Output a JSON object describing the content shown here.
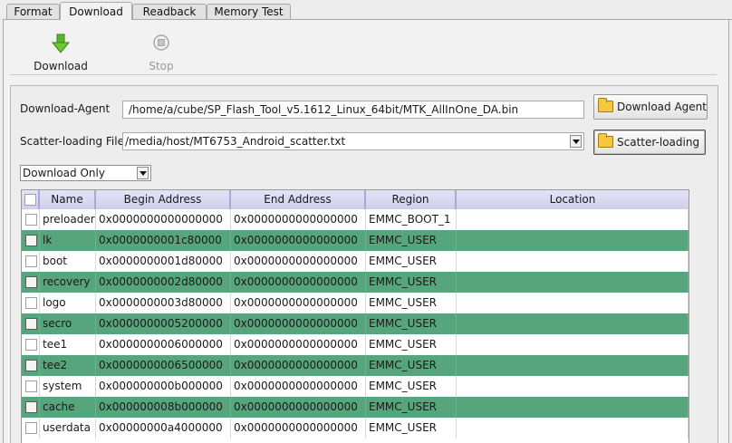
{
  "tabs": [
    {
      "label": "Format",
      "active": false
    },
    {
      "label": "Download",
      "active": true
    },
    {
      "label": "Readback",
      "active": false
    },
    {
      "label": "Memory Test",
      "active": false
    }
  ],
  "toolbar": {
    "download_label": "Download",
    "stop_label": "Stop",
    "download_icon": "green-down-arrow-icon",
    "stop_icon": "stop-icon"
  },
  "download_agent": {
    "label": "Download-Agent",
    "value": "/home/a/cube/SP_Flash_Tool_v5.1612_Linux_64bit/MTK_AllInOne_DA.bin",
    "button_label": "Download Agent"
  },
  "scatter": {
    "label": "Scatter-loading File",
    "value": "/media/host/MT6753_Android_scatter.txt",
    "button_label": "Scatter-loading"
  },
  "mode": {
    "selected": "Download Only"
  },
  "table": {
    "columns": [
      "Name",
      "Begin Address",
      "End Address",
      "Region",
      "Location"
    ],
    "rows": [
      {
        "name": "preloader",
        "begin": "0x0000000000000000",
        "end": "0x0000000000000000",
        "region": "EMMC_BOOT_1",
        "location": "",
        "highlight": false
      },
      {
        "name": "lk",
        "begin": "0x0000000001c80000",
        "end": "0x0000000000000000",
        "region": "EMMC_USER",
        "location": "",
        "highlight": true
      },
      {
        "name": "boot",
        "begin": "0x0000000001d80000",
        "end": "0x0000000000000000",
        "region": "EMMC_USER",
        "location": "",
        "highlight": false
      },
      {
        "name": "recovery",
        "begin": "0x0000000002d80000",
        "end": "0x0000000000000000",
        "region": "EMMC_USER",
        "location": "",
        "highlight": true
      },
      {
        "name": "logo",
        "begin": "0x0000000003d80000",
        "end": "0x0000000000000000",
        "region": "EMMC_USER",
        "location": "",
        "highlight": false
      },
      {
        "name": "secro",
        "begin": "0x0000000005200000",
        "end": "0x0000000000000000",
        "region": "EMMC_USER",
        "location": "",
        "highlight": true
      },
      {
        "name": "tee1",
        "begin": "0x0000000006000000",
        "end": "0x0000000000000000",
        "region": "EMMC_USER",
        "location": "",
        "highlight": false
      },
      {
        "name": "tee2",
        "begin": "0x0000000006500000",
        "end": "0x0000000000000000",
        "region": "EMMC_USER",
        "location": "",
        "highlight": true
      },
      {
        "name": "system",
        "begin": "0x000000000b000000",
        "end": "0x0000000000000000",
        "region": "EMMC_USER",
        "location": "",
        "highlight": false
      },
      {
        "name": "cache",
        "begin": "0x000000008b000000",
        "end": "0x0000000000000000",
        "region": "EMMC_USER",
        "location": "",
        "highlight": true
      },
      {
        "name": "userdata",
        "begin": "0x00000000a4000000",
        "end": "0x0000000000000000",
        "region": "EMMC_USER",
        "location": "",
        "highlight": false
      }
    ]
  },
  "colors": {
    "row_highlight": "#57a57c",
    "header_bg": "#d8d8f0",
    "window_bg": "#ededed"
  }
}
